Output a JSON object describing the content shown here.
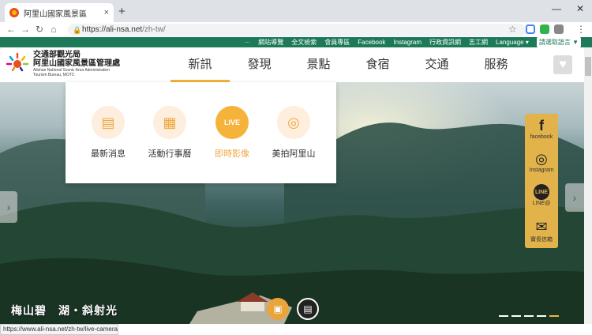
{
  "browser": {
    "tab_title": "阿里山國家風景區",
    "tab_close": "×",
    "new_tab": "+",
    "url_host": "https://ali-nsa.net",
    "url_path": "/zh-tw/",
    "status_url": "https://www.ali-nsa.net/zh-tw/live-camera"
  },
  "topstrip": {
    "links": [
      "網站導覽",
      "全文檢索",
      "會員專區",
      "Facebook",
      "Instagram",
      "行政資訊網",
      "志工網",
      "Language ▾"
    ],
    "translate": "請選取語言 ▼"
  },
  "logo": {
    "line1": "交通部觀光局",
    "line2": "阿里山國家風景區管理處",
    "line3": "Alishan National Scenic Area Administration",
    "line4": "Tourism Bureau, MOTC"
  },
  "nav": {
    "items": [
      "新訊",
      "發現",
      "景點",
      "食宿",
      "交通",
      "服務"
    ],
    "active": "新訊"
  },
  "dropdown": {
    "items": [
      {
        "label": "最新消息",
        "icon": "news-icon"
      },
      {
        "label": "活動行事曆",
        "icon": "calendar-icon"
      },
      {
        "label": "即時影像",
        "icon": "live-camera-icon"
      },
      {
        "label": "美拍阿里山",
        "icon": "instagram-icon"
      }
    ],
    "active": "即時影像"
  },
  "social": {
    "items": [
      {
        "label": "facebook",
        "glyph": "f"
      },
      {
        "label": "Instagram",
        "glyph": "◎"
      },
      {
        "label": "LINE@",
        "glyph": "LINE"
      },
      {
        "label": "實長信箱",
        "glyph": "✉"
      }
    ]
  },
  "hero": {
    "caption": "梅山碧　湖・斜射光",
    "slide_count": 5
  },
  "colors": {
    "accent": "#f5b33b",
    "topstrip": "#1c7a58",
    "social_bg": "#e2b24b"
  }
}
